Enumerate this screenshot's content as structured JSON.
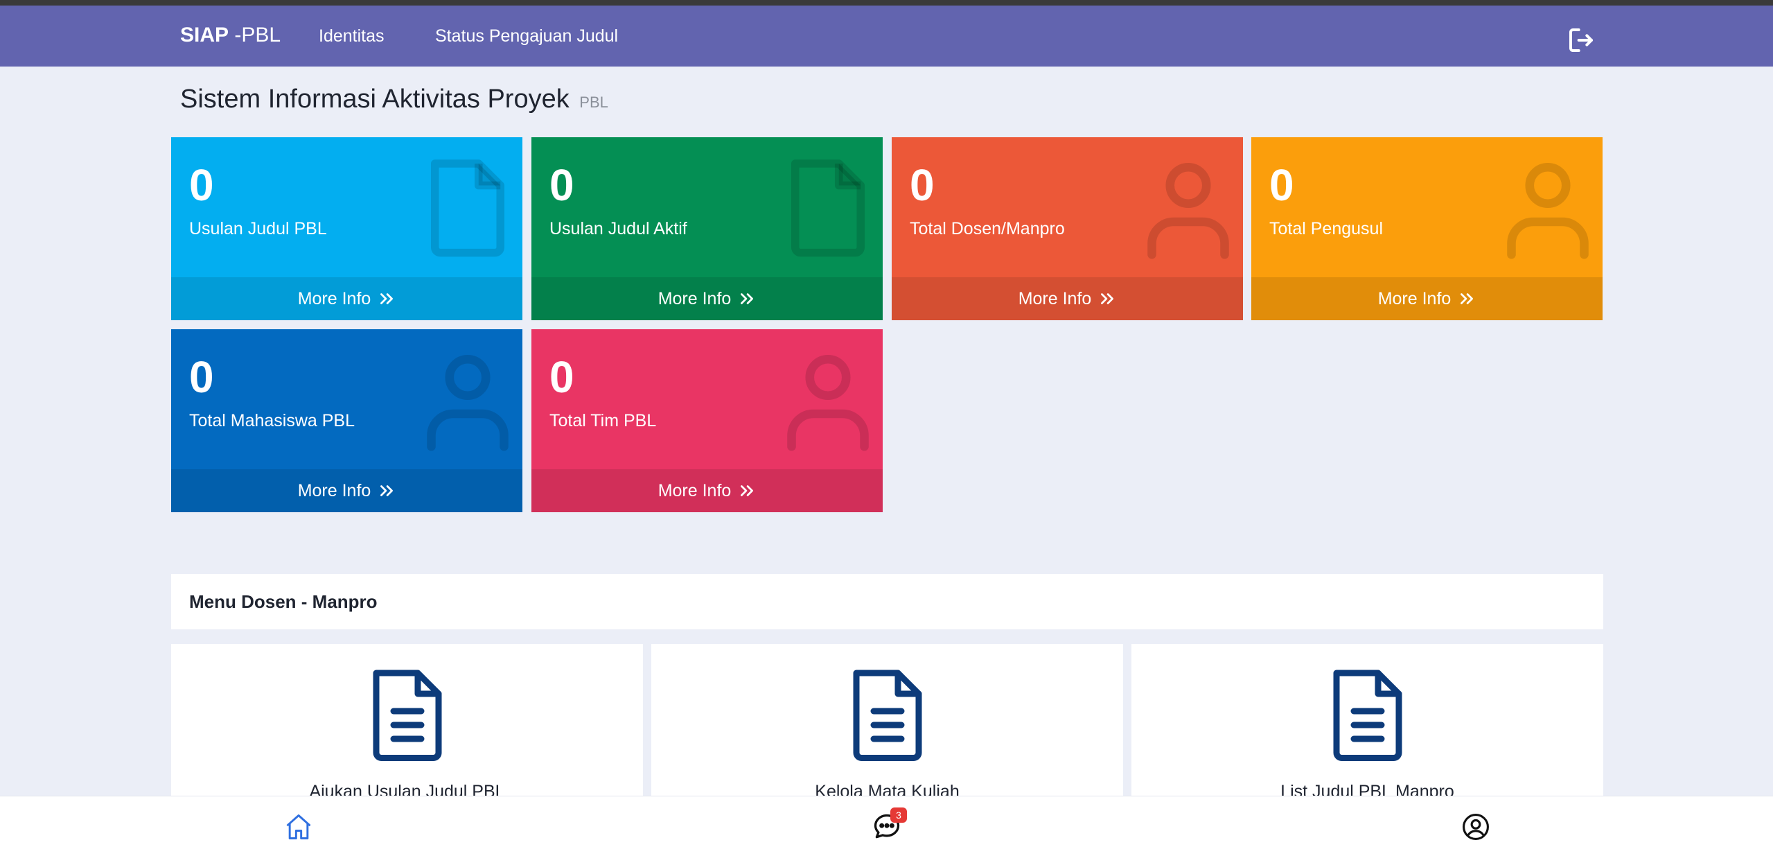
{
  "navbar": {
    "brand_bold": "SIAP",
    "brand_rest": " -PBL",
    "links": [
      "Identitas",
      "Status Pengajuan Judul"
    ],
    "logout_icon": "logout-icon"
  },
  "page": {
    "title": "Sistem Informasi Aktivitas Proyek",
    "subtitle": "PBL"
  },
  "stat_cards": [
    {
      "count": "0",
      "label": "Usulan Judul PBL",
      "more": "More Info",
      "icon": "file-icon",
      "color": "#03aef0"
    },
    {
      "count": "0",
      "label": "Usulan Judul Aktif",
      "more": "More Info",
      "icon": "file-icon",
      "color": "#048f54"
    },
    {
      "count": "0",
      "label": "Total Dosen/Manpro",
      "more": "More Info",
      "icon": "user-icon",
      "color": "#ec5838"
    },
    {
      "count": "0",
      "label": "Total Pengusul",
      "more": "More Info",
      "icon": "user-icon",
      "color": "#fb9e0c"
    },
    {
      "count": "0",
      "label": "Total Mahasiswa PBL",
      "more": "More Info",
      "icon": "user-icon",
      "color": "#036ac0"
    },
    {
      "count": "0",
      "label": "Total Tim PBL",
      "more": "More Info",
      "icon": "user-icon",
      "color": "#e93564"
    }
  ],
  "menu": {
    "header": "Menu Dosen - Manpro",
    "items": [
      {
        "label": "Ajukan Usulan Judul PBL",
        "icon": "document-icon"
      },
      {
        "label": "Kelola Mata Kuliah",
        "icon": "document-icon"
      },
      {
        "label": "List Judul PBL Manpro",
        "icon": "document-icon"
      }
    ]
  },
  "bottom_nav": {
    "items": [
      "home-icon",
      "chat-icon",
      "profile-icon"
    ],
    "chat_badge": "3",
    "active_color": "#2f6fe0"
  }
}
